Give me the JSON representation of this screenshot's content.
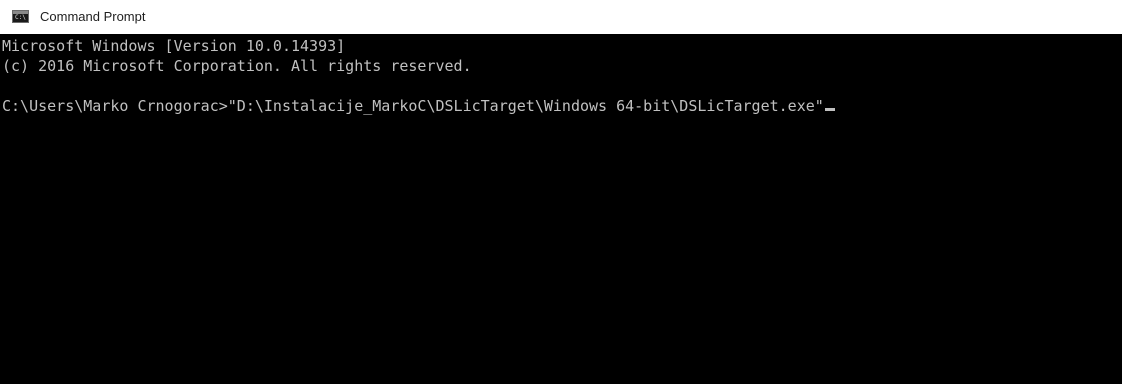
{
  "window": {
    "title": "Command Prompt",
    "icon": "console-app-icon",
    "icon_glyph": "C:\\"
  },
  "console": {
    "lines": [
      "Microsoft Windows [Version 10.0.14393]",
      "(c) 2016 Microsoft Corporation. All rights reserved.",
      "C:\\Users\\Marko Crnogorac>\"D:\\Instalacije_MarkoC\\DSLicTarget\\Windows 64-bit\\DSLicTarget.exe\""
    ]
  },
  "colors": {
    "console_background": "#000000",
    "console_text": "#c0c0c0",
    "titlebar_background": "#ffffff"
  }
}
